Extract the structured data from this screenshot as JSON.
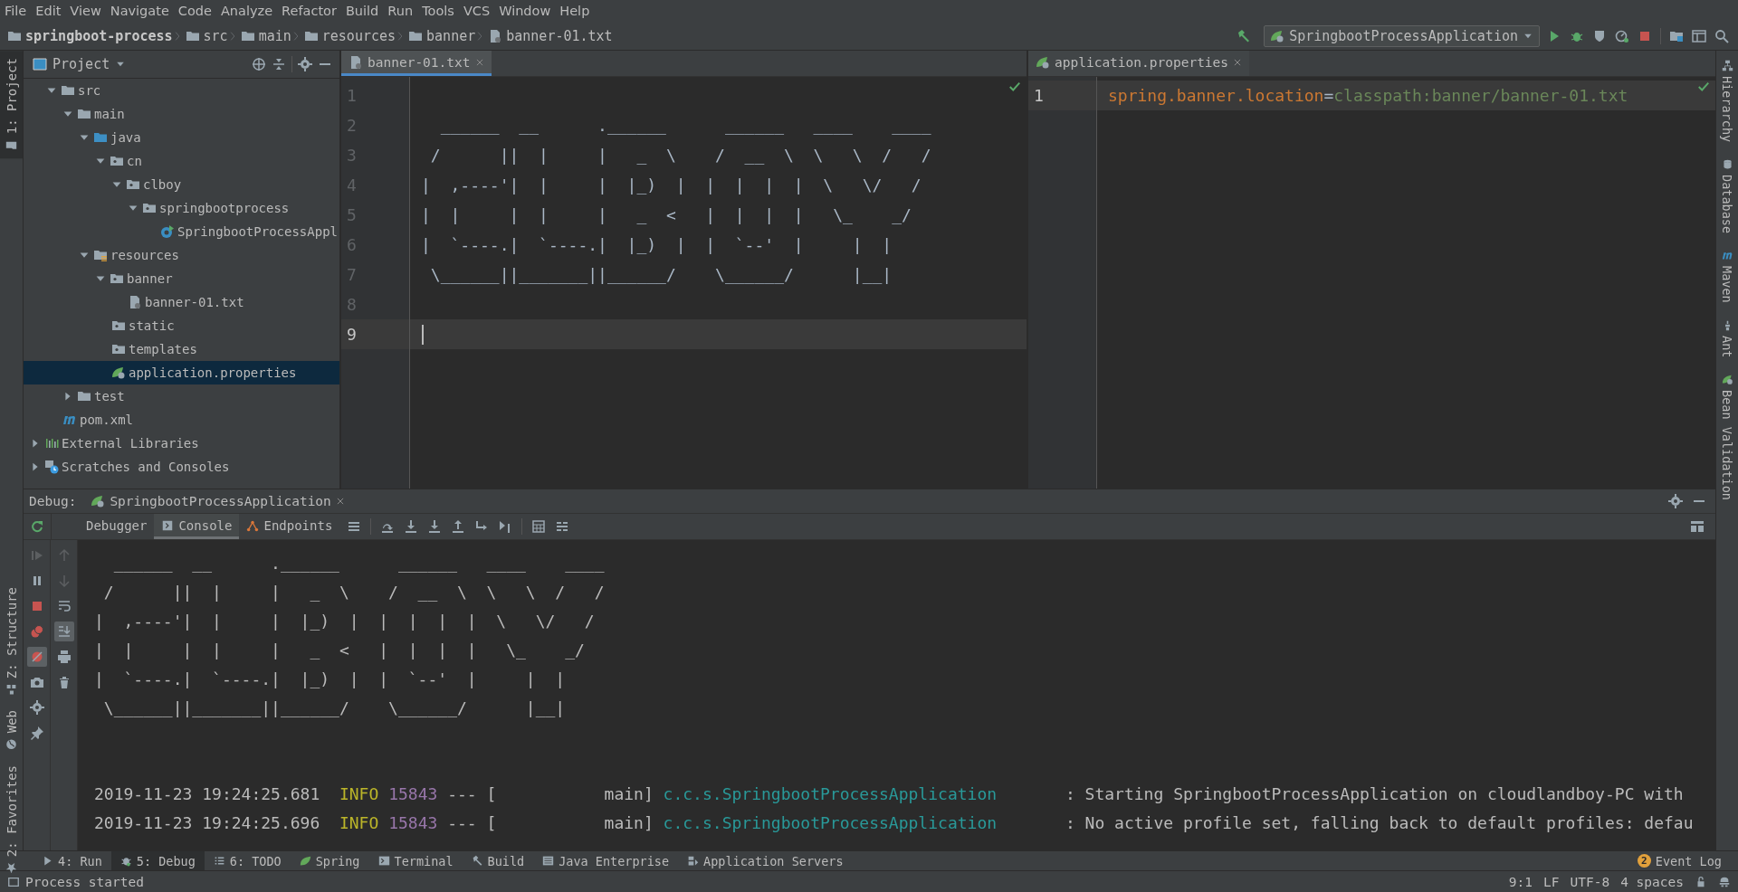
{
  "menu": [
    "File",
    "Edit",
    "View",
    "Navigate",
    "Code",
    "Analyze",
    "Refactor",
    "Build",
    "Run",
    "Tools",
    "VCS",
    "Window",
    "Help"
  ],
  "breadcrumbs": [
    {
      "label": "springboot-process",
      "kind": "project"
    },
    {
      "label": "src",
      "kind": "folder"
    },
    {
      "label": "main",
      "kind": "folder"
    },
    {
      "label": "resources",
      "kind": "folder"
    },
    {
      "label": "banner",
      "kind": "folder"
    },
    {
      "label": "banner-01.txt",
      "kind": "file"
    }
  ],
  "run_config": {
    "label": "SpringbootProcessApplication"
  },
  "left_stripe": [
    {
      "label": "1: Project",
      "selected": true
    },
    {
      "label": "Z: Structure",
      "selected": false
    },
    {
      "label": "Web",
      "selected": false
    },
    {
      "label": "2: Favorites",
      "selected": false
    }
  ],
  "right_stripe": [
    "Hierarchy",
    "Database",
    "Maven",
    "Ant",
    "Bean Validation"
  ],
  "project_panel": {
    "title": "Project",
    "tree": {
      "root_children": [
        {
          "label": "src",
          "kind": "folder",
          "expanded": true,
          "selected": false,
          "children": [
            {
              "label": "main",
              "kind": "folder",
              "expanded": true,
              "selected": false,
              "children": [
                {
                  "label": "java",
                  "kind": "source-root",
                  "expanded": true,
                  "selected": false,
                  "children": [
                    {
                      "label": "cn",
                      "kind": "package",
                      "expanded": true,
                      "selected": false,
                      "children": [
                        {
                          "label": "clboy",
                          "kind": "package",
                          "expanded": true,
                          "selected": false,
                          "children": [
                            {
                              "label": "springbootprocess",
                              "kind": "package",
                              "expanded": true,
                              "selected": false,
                              "children": [
                                {
                                  "label": "SpringbootProcessAppl",
                                  "kind": "spring-class",
                                  "selected": false
                                }
                              ]
                            }
                          ]
                        }
                      ]
                    }
                  ]
                },
                {
                  "label": "resources",
                  "kind": "resources-root",
                  "expanded": true,
                  "selected": false,
                  "children": [
                    {
                      "label": "banner",
                      "kind": "package",
                      "expanded": true,
                      "selected": false,
                      "children": [
                        {
                          "label": "banner-01.txt",
                          "kind": "text-file",
                          "selected": false
                        }
                      ]
                    },
                    {
                      "label": "static",
                      "kind": "package",
                      "selected": false
                    },
                    {
                      "label": "templates",
                      "kind": "package",
                      "selected": false
                    },
                    {
                      "label": "application.properties",
                      "kind": "properties",
                      "selected": true
                    }
                  ]
                }
              ]
            },
            {
              "label": "test",
              "kind": "folder",
              "expanded": false,
              "selected": false
            }
          ]
        },
        {
          "label": "pom.xml",
          "kind": "maven",
          "selected": false
        }
      ],
      "top_level": [
        {
          "label": "External Libraries",
          "kind": "libraries",
          "expanded": false,
          "selected": false
        },
        {
          "label": "Scratches and Consoles",
          "kind": "scratches",
          "expanded": false,
          "selected": false
        }
      ]
    }
  },
  "editors": [
    {
      "tab": "banner-01.txt",
      "focused": true,
      "lines": [
        {
          "number": "1",
          "current": false
        },
        {
          "number": "2",
          "current": false,
          "text": "  ______  __      .______      ______   ____    ____"
        },
        {
          "number": "3",
          "current": false,
          "text": " /      ||  |     |   _  \\    /  __  \\  \\   \\  /   /"
        },
        {
          "number": "4",
          "current": false,
          "text": "|  ,----'|  |     |  |_)  |  |  |  |  |  \\   \\/   /"
        },
        {
          "number": "5",
          "current": false,
          "text": "|  |     |  |     |   _  <   |  |  |  |   \\_    _/"
        },
        {
          "number": "6",
          "current": false,
          "text": "|  `----.|  `----.|  |_)  |  |  `--'  |     |  |"
        },
        {
          "number": "7",
          "current": false,
          "text": " \\______||_______||______/    \\______/      |__|"
        },
        {
          "number": "8",
          "current": false
        },
        {
          "number": "9",
          "current": true
        }
      ]
    },
    {
      "tab": "application.properties",
      "focused": false,
      "lines": [
        {
          "number": "1",
          "current": true,
          "parts": [
            {
              "kind": "key",
              "text": "spring.banner.location"
            },
            {
              "kind": "separator",
              "text": "="
            },
            {
              "kind": "value",
              "text": "classpath:banner/banner-01.txt"
            }
          ]
        }
      ]
    }
  ],
  "debug": {
    "title": "Debug:",
    "session": "SpringbootProcessApplication",
    "tabs": [
      {
        "label": "Debugger",
        "selected": false
      },
      {
        "label": "Console",
        "selected": true
      },
      {
        "label": "Endpoints",
        "selected": false
      }
    ],
    "mute_breakpoints": {
      "on": true
    },
    "scroll_to_end": {
      "on": true
    },
    "console": {
      "banner": [
        "  ______  __      .______      ______   ____    ____",
        " /      ||  |     |   _  \\    /  __  \\  \\   \\  /   /",
        "|  ,----'|  |     |  |_)  |  |  |  |  |  \\   \\/   /",
        "|  |     |  |     |   _  <   |  |  |  |   \\_    _/",
        "|  `----.|  `----.|  |_)  |  |  `--'  |     |  |",
        " \\______||_______||______/    \\______/      |__|"
      ],
      "log": [
        {
          "date": "2019-11-23 19:24:25.681",
          "level": "INFO",
          "pid": "15843",
          "separator": "---",
          "thread": "[           main]",
          "logger": "c.c.s.SpringbootProcessApplication",
          "message": ": Starting SpringbootProcessApplication on cloudlandboy-PC with"
        },
        {
          "date": "2019-11-23 19:24:25.696",
          "level": "INFO",
          "pid": "15843",
          "separator": "---",
          "thread": "[           main]",
          "logger": "c.c.s.SpringbootProcessApplication",
          "message": ": No active profile set, falling back to default profiles: defau"
        }
      ]
    }
  },
  "tool_tabs": [
    {
      "label": "4: Run",
      "kind": "run",
      "selected": false
    },
    {
      "label": "5: Debug",
      "kind": "debug",
      "selected": true
    },
    {
      "label": "6: TODO",
      "kind": "todo",
      "selected": false
    },
    {
      "label": "Spring",
      "kind": "spring",
      "selected": false
    },
    {
      "label": "Terminal",
      "kind": "terminal",
      "selected": false
    },
    {
      "label": "Build",
      "kind": "build",
      "selected": false
    },
    {
      "label": "Java Enterprise",
      "kind": "enterprise",
      "selected": false
    },
    {
      "label": "Application Servers",
      "kind": "servers",
      "selected": false
    }
  ],
  "event_log": {
    "label": "Event Log",
    "badge": "2"
  },
  "status": {
    "message": "Process started",
    "position": "9:1",
    "line_separator": "LF",
    "encoding": "UTF-8",
    "indent": "4 spaces"
  }
}
